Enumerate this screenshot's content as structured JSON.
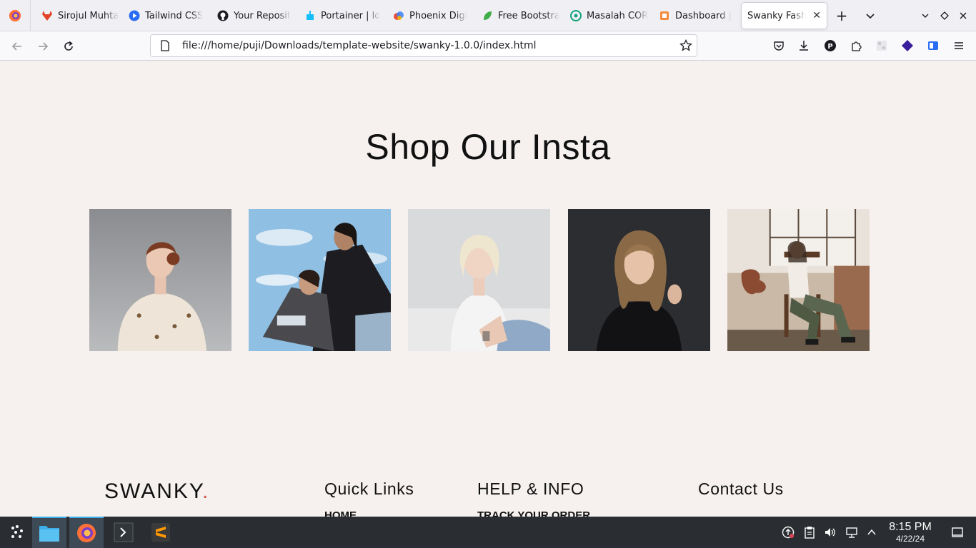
{
  "browser": {
    "tabs": [
      {
        "label": "Sirojul Muhta",
        "icon": "gitlab-icon"
      },
      {
        "label": "Tailwind CSS",
        "icon": "play-circle-icon"
      },
      {
        "label": "Your Reposit",
        "icon": "github-icon"
      },
      {
        "label": "Portainer | lo",
        "icon": "portainer-icon"
      },
      {
        "label": "Phoenix Digi",
        "icon": "phoenix-icon"
      },
      {
        "label": "Free Bootstra",
        "icon": "leaf-icon"
      },
      {
        "label": "Masalah COR",
        "icon": "chatgpt-icon"
      },
      {
        "label": "Dashboard |",
        "icon": "dashboard-icon"
      },
      {
        "label": "Swanky Fashio",
        "icon": "none",
        "active": true
      }
    ],
    "url": "file:///home/puji/Downloads/template-website/swanky-1.0.0/index.html"
  },
  "page": {
    "section_title": "Shop Our Insta",
    "footer": {
      "logo": "SWANKY",
      "logo_dot": ".",
      "quick_links_heading": "Quick Links",
      "quick_links_first": "HOME",
      "help_heading": "HELP & INFO",
      "help_first": "TRACK YOUR ORDER",
      "contact_heading": "Contact Us"
    }
  },
  "taskbar": {
    "time": "8:15 PM",
    "date": "4/22/24"
  },
  "colors": {
    "page_bg": "#f6f1ef",
    "accent_dot": "#d9534f",
    "taskbar_bg": "#2a2e32"
  }
}
